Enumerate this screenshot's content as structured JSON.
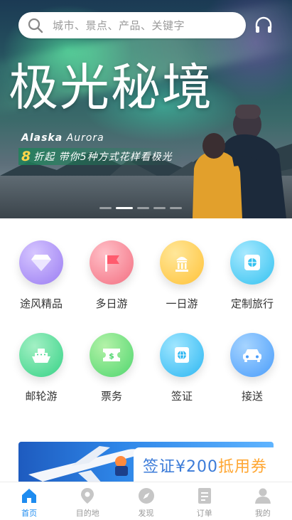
{
  "search": {
    "placeholder": "城市、景点、产品、关键字"
  },
  "banner": {
    "title": "极光秘境",
    "subtitle_bold": "Alaska",
    "subtitle_light": "Aurora",
    "promo_number": "8",
    "promo_text": "折起 带你5种方式花样看极光",
    "slides_total": 5,
    "slide_active": 2
  },
  "categories": [
    {
      "label": "途风精品",
      "icon": "diamond-icon",
      "color": "#9a7cf2"
    },
    {
      "label": "多日游",
      "icon": "flag-icon",
      "color": "#f36f81"
    },
    {
      "label": "一日游",
      "icon": "landmark-icon",
      "color": "#ffc238"
    },
    {
      "label": "定制旅行",
      "icon": "custom-trip-icon",
      "color": "#34c2f0"
    },
    {
      "label": "邮轮游",
      "icon": "cruise-ship-icon",
      "color": "#35d286"
    },
    {
      "label": "票务",
      "icon": "ticket-icon",
      "color": "#4fd66e"
    },
    {
      "label": "签证",
      "icon": "visa-icon",
      "color": "#2cb7f2"
    },
    {
      "label": "接送",
      "icon": "car-icon",
      "color": "#4a9dfb"
    }
  ],
  "promo": {
    "text_main": "签证¥200",
    "text_accent": "抵用券"
  },
  "tabbar": [
    {
      "label": "首页",
      "icon": "home-icon",
      "active": true
    },
    {
      "label": "目的地",
      "icon": "location-pin-icon",
      "active": false
    },
    {
      "label": "发现",
      "icon": "compass-icon",
      "active": false
    },
    {
      "label": "订单",
      "icon": "order-list-icon",
      "active": false
    },
    {
      "label": "我的",
      "icon": "user-icon",
      "active": false
    }
  ],
  "colors": {
    "accent": "#1e8cf0",
    "inactive": "#9a9a9a",
    "promo_accent": "#ffa733"
  }
}
